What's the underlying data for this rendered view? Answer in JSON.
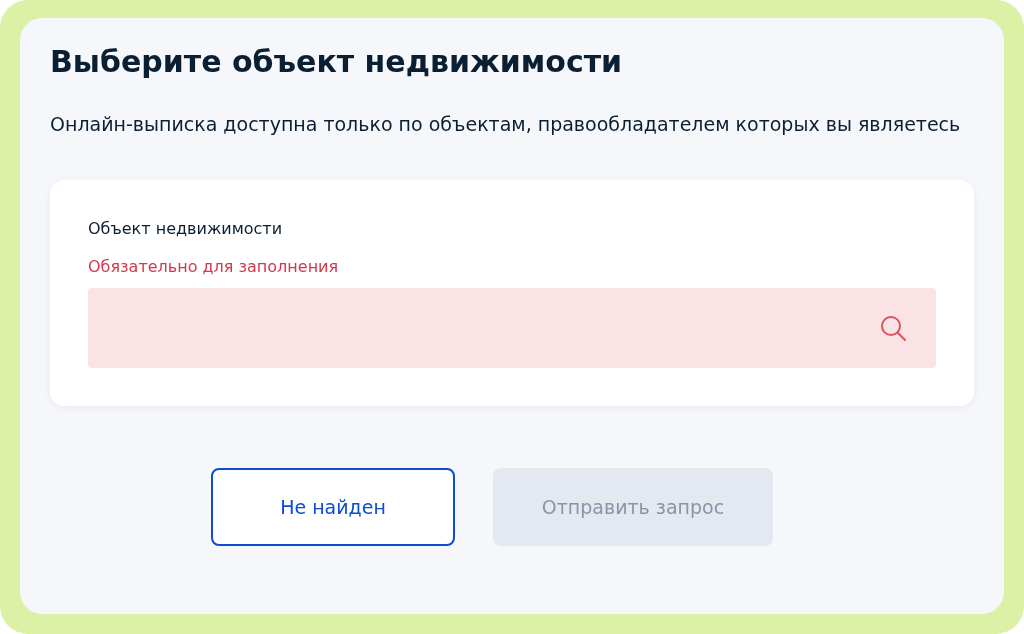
{
  "title": "Выберите объект недвижимости",
  "description": "Онлайн-выписка доступна только по объектам, правообладателем которых вы являетесь",
  "field": {
    "label": "Объект недвижимости",
    "error": "Обязательно для заполнения"
  },
  "buttons": [
    {
      "label": "Не найден",
      "kind": "outline",
      "disabled": false
    },
    {
      "label": "Отправить запрос",
      "kind": "primary",
      "disabled": true
    }
  ]
}
